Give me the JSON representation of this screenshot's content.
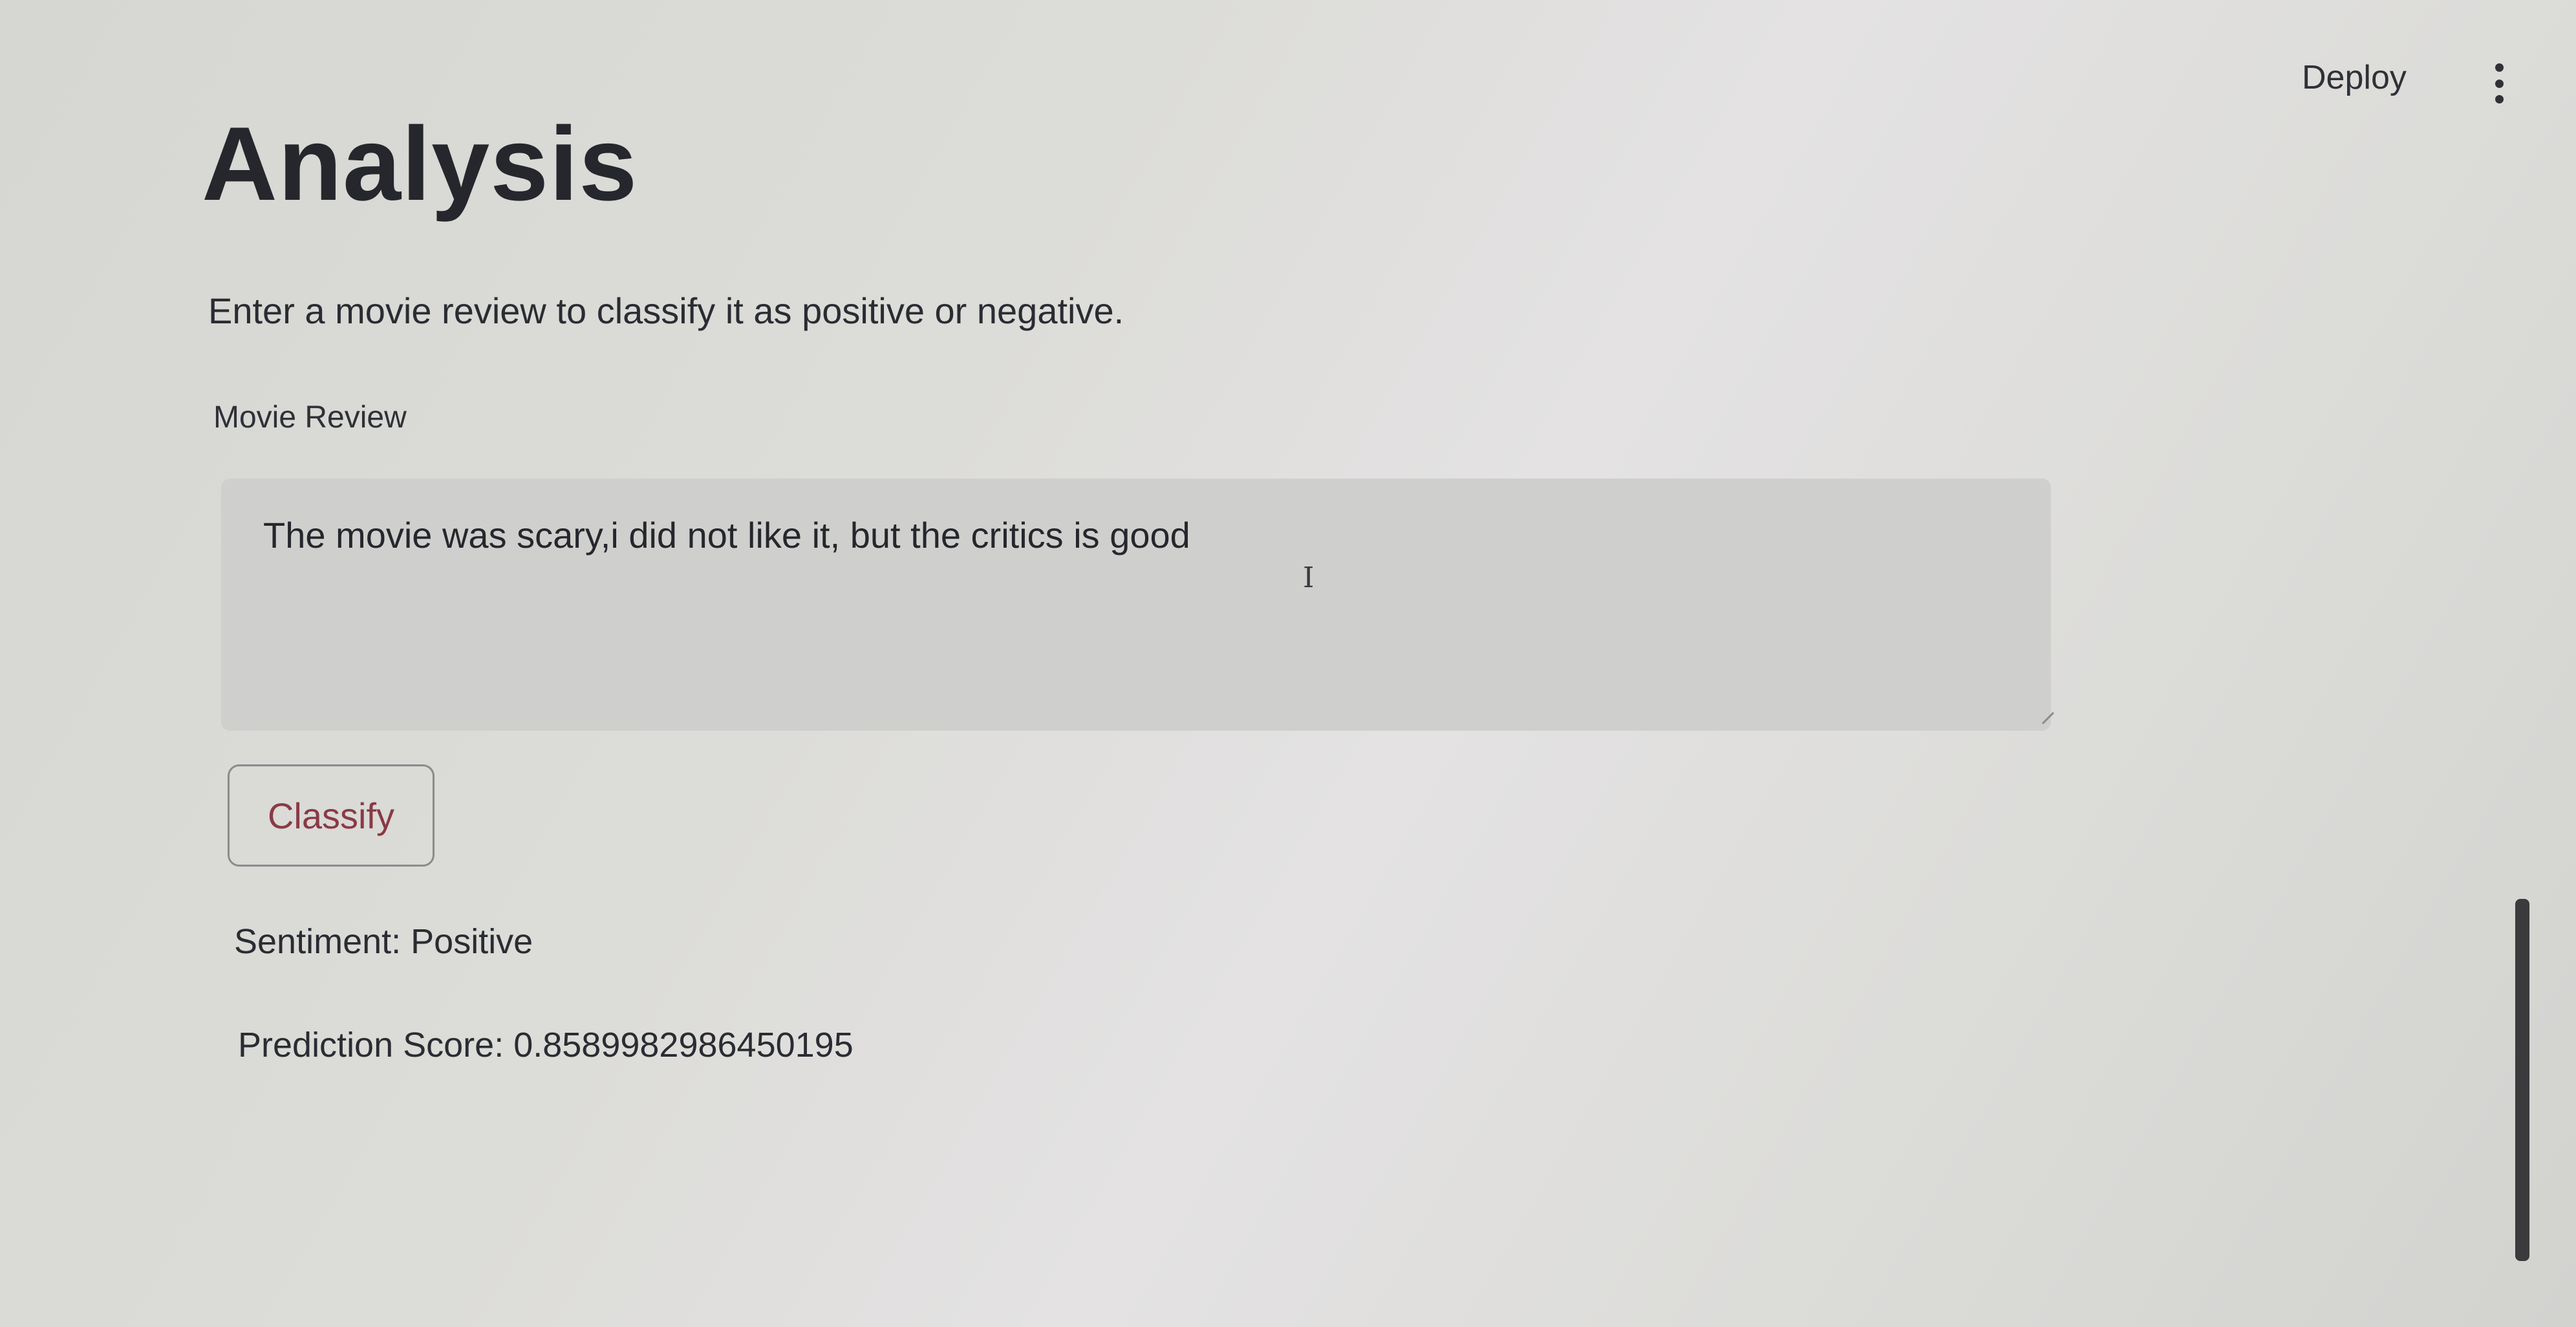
{
  "header": {
    "deploy_label": "Deploy",
    "menu_icon": "kebab-menu-icon"
  },
  "main": {
    "title": "Analysis",
    "description": "Enter a movie review to classify it as positive or negative.",
    "review_field": {
      "label": "Movie Review",
      "value": "The movie was scary,i did not like it, but the critics is good"
    },
    "classify_button_label": "Classify",
    "results": {
      "sentiment": "Sentiment: Positive",
      "prediction_score": "Prediction Score: 0.8589982986450195"
    }
  },
  "colors": {
    "button_text": "#8a3a46",
    "textarea_bg": "#cfd0cd"
  }
}
